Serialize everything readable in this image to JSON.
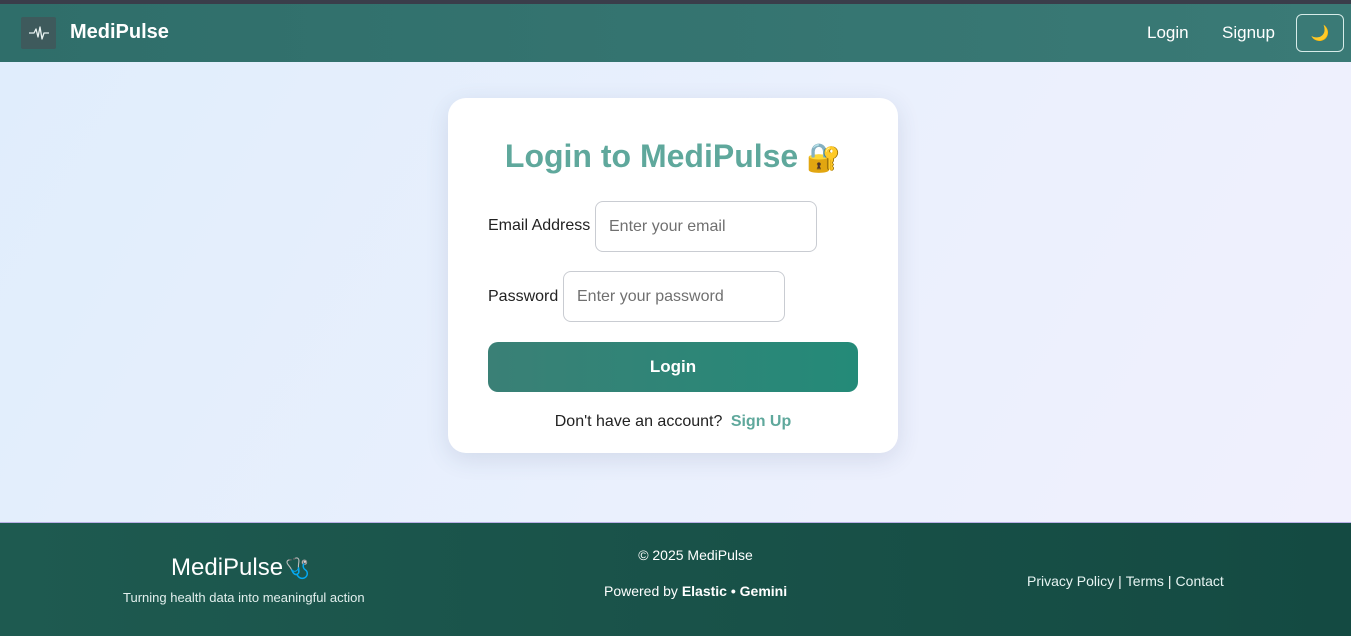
{
  "nav": {
    "brand": "MediPulse",
    "logo_icon": "heartbeat-icon",
    "login_label": "Login",
    "signup_label": "Signup",
    "theme_icon": "moon-icon",
    "theme_glyph": "🌙"
  },
  "login_card": {
    "title": "Login to MediPulse",
    "title_emoji": "🔐",
    "email_label": "Email Address",
    "email_placeholder": "Enter your email",
    "password_label": "Password",
    "password_placeholder": "Enter your password",
    "submit_label": "Login",
    "no_account_text": "Don't have an account?",
    "signup_link": "Sign Up"
  },
  "footer": {
    "brand": "MediPulse",
    "brand_emoji": "🩺",
    "tagline": "Turning health data into meaningful action",
    "copyright": "© 2025 MediPulse",
    "powered_prefix": "Powered by",
    "powered_names": "Elastic • Gemini",
    "links": [
      "Privacy Policy",
      "Terms",
      "Contact"
    ]
  },
  "colors": {
    "navbar": "#2f6e6a",
    "accent": "#5fa89c",
    "button": "#248a78",
    "footer": "#1e5a50"
  }
}
